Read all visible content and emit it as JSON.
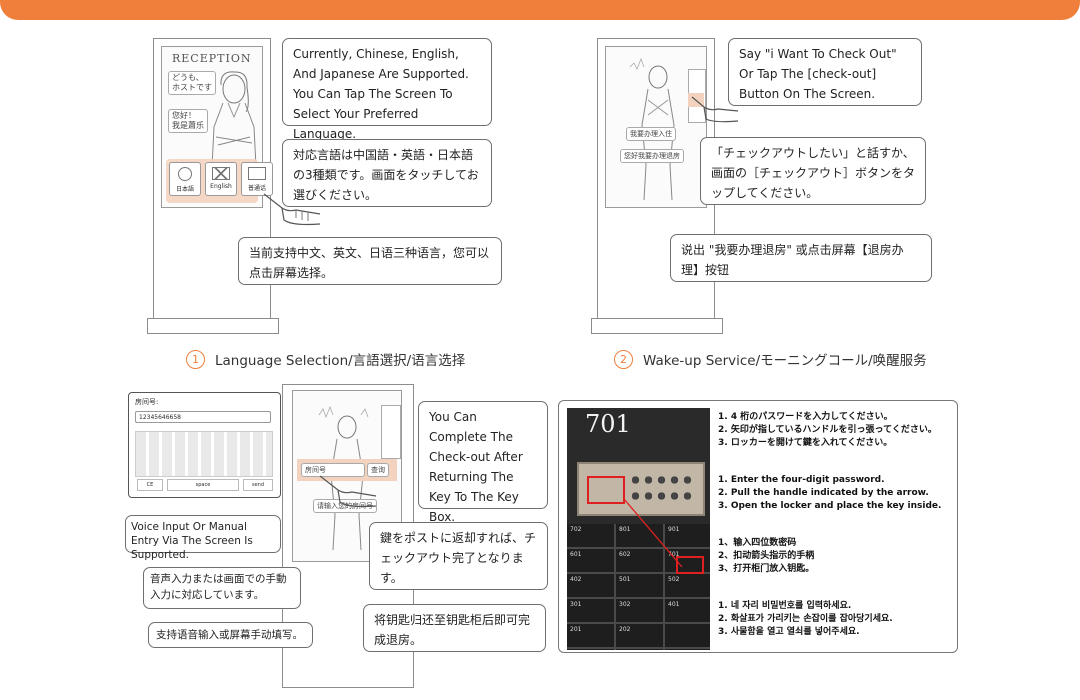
{
  "sections": [
    {
      "number": "1",
      "caption": "Language Selection/言語選択/语言选择",
      "screen_title": "RECEPTION",
      "greeting_ja": "どうも、\nホストです",
      "greeting_zh": "您好！\n我是蕭乐",
      "lang_buttons": [
        "日本語",
        "English",
        "普通话"
      ],
      "bubble_en": "Currently, Chinese, English, And Japanese Are Supported. You Can Tap The Screen To Select Your Preferred Language.",
      "bubble_ja": "対応言語は中国語・英語・日本語の3種類です。画面をタッチしてお選びください。",
      "bubble_zh": "当前支持中文、英文、日语三种语言，您可以点击屏幕选择。"
    },
    {
      "number": "2",
      "caption": "Wake-up Service/モーニングコール/唤醒服务",
      "mini_labels": [
        "我要办理入住",
        "您好我要办理退房"
      ],
      "bubble_en": "Say \"i Want To Check Out\" Or Tap The [check-out] Button On The Screen.",
      "bubble_ja": "「チェックアウトしたい」と話すか、画面の［チェックアウト］ボタンをタップしてください。",
      "bubble_zh": "说出 \"我要办理退房\" 或点击屏幕【退房办理】按钮"
    },
    {
      "room_label": "房间号:",
      "room_value": "12345646658",
      "keyboard_keys": [
        "CE",
        "space",
        "send"
      ],
      "screen_input": "房间号",
      "screen_button": "查询",
      "screen_hint": "请输入您的房间号",
      "bubble_voice_en": "Voice Input Or Manual Entry Via The Screen Is Supported.",
      "bubble_voice_ja": "音声入力または画面での手動入力に対応しています。",
      "bubble_voice_zh": "支持语音输入或屏幕手动填写。",
      "bubble_return_en": "You Can Complete The Check-out After Returning The Key To The Key Box.",
      "bubble_return_ja": "鍵をポストに返却すれば、チェックアウト完了となります。",
      "bubble_return_zh": "将钥匙归还至钥匙柜后即可完成退房。"
    }
  ],
  "locker": {
    "room_number": "701",
    "locker_numbers": [
      "702",
      "801",
      "901",
      "601",
      "602",
      "701",
      "402",
      "501",
      "502",
      "301",
      "302",
      "401",
      "201",
      "202"
    ],
    "steps_ja": [
      "1. 4 桁のパスワードを入力してください。",
      "2. 矢印が指しているハンドルを引っ張ってください。",
      "3. ロッカーを開けて鍵を入れてください。"
    ],
    "steps_en": [
      "1.  Enter the four-digit password.",
      "2.  Pull the handle indicated by the arrow.",
      "3.  Open the locker and place the key inside."
    ],
    "steps_zh": [
      "1、输入四位数密码",
      "2、扣动箭头指示的手柄",
      "3、打开柜门放入钥匙。"
    ],
    "steps_ko": [
      "1. 네 자리 비밀번호를 입력하세요.",
      "2. 화살표가 가리키는 손잡이를 잡아당기세요.",
      "3. 사물함을 열고 열쇠를 넣어주세요."
    ]
  },
  "colors": {
    "accent": "#f07f3c",
    "highlight": "#f3d3bf"
  }
}
